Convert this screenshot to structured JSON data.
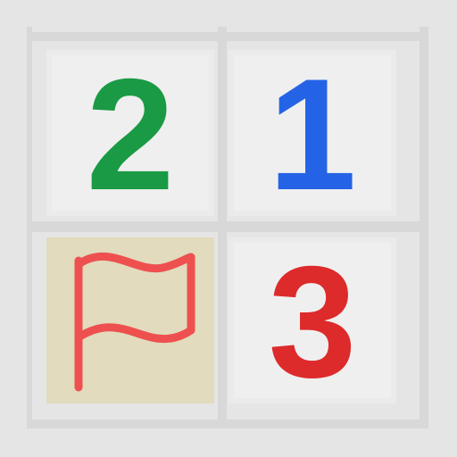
{
  "board": {
    "cells": [
      {
        "state": "revealed",
        "value": "2",
        "color": "#1a9a44"
      },
      {
        "state": "revealed",
        "value": "1",
        "color": "#2563e6"
      },
      {
        "state": "flagged",
        "icon": "flag-icon",
        "color": "#ee5050"
      },
      {
        "state": "revealed",
        "value": "3",
        "color": "#dd2a2a"
      }
    ]
  }
}
